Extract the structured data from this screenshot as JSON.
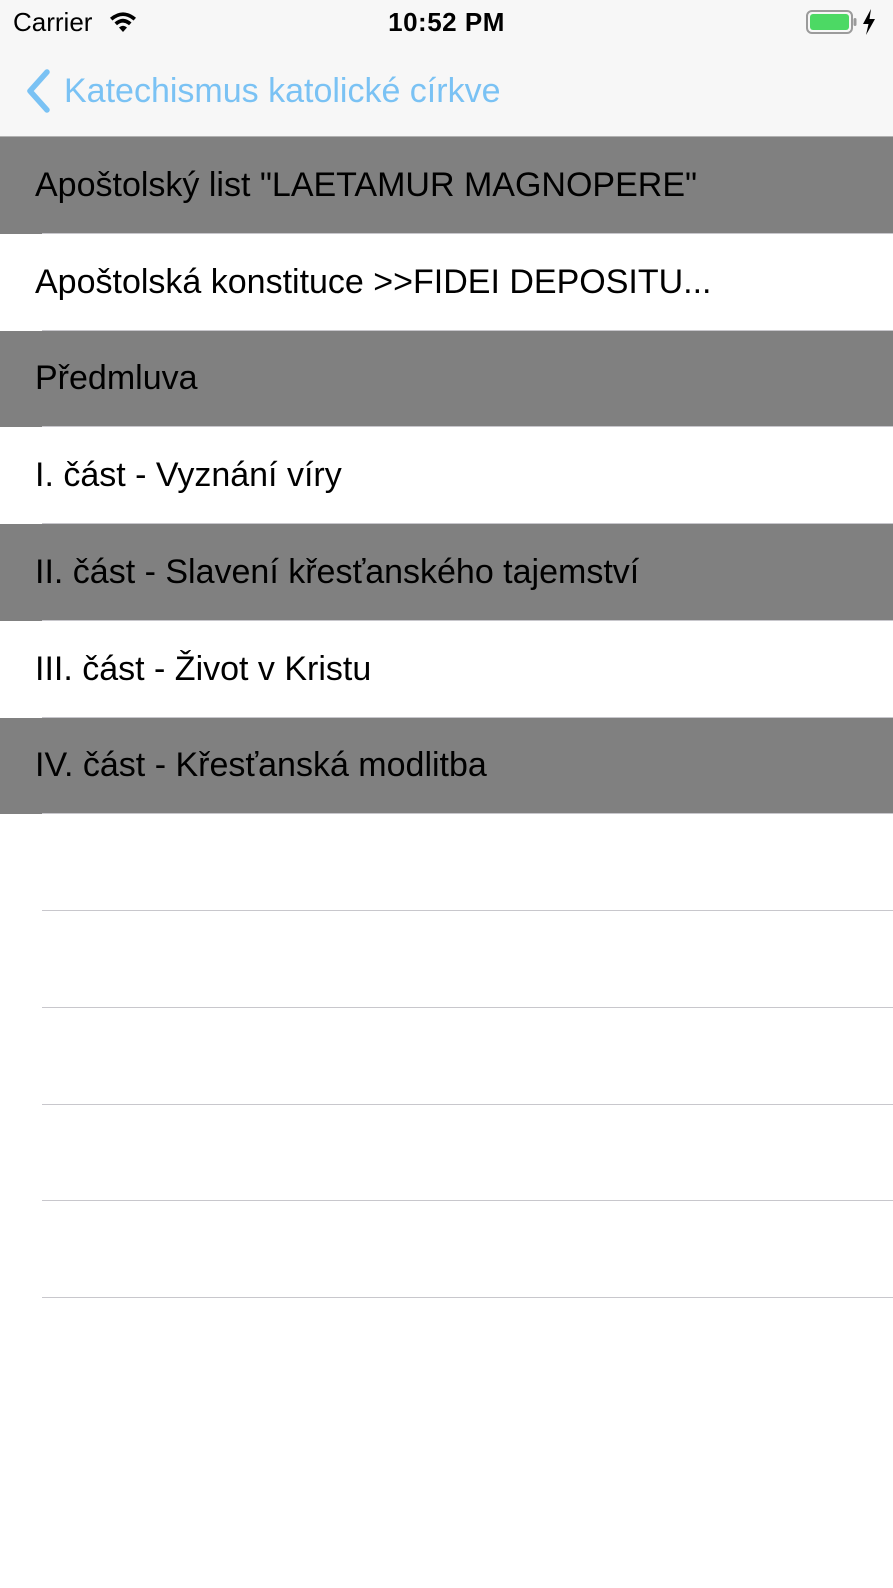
{
  "status_bar": {
    "carrier": "Carrier",
    "time": "10:52 PM",
    "battery_color": "#4cd964"
  },
  "nav": {
    "back_label": "Katechismus katolické církve",
    "accent_color": "#7ac2f4"
  },
  "list": {
    "items": [
      {
        "label": "Apoštolský list \"LAETAMUR MAGNOPERE\""
      },
      {
        "label": "Apoštolská konstituce >>FIDEI DEPOSITU..."
      },
      {
        "label": "Předmluva"
      },
      {
        "label": "I. část - Vyznání víry"
      },
      {
        "label": "II. část - Slavení křesťanského tajemství"
      },
      {
        "label": "III. část - Život v Kristu"
      },
      {
        "label": "IV. část - Křesťanská modlitba"
      }
    ],
    "shaded_color": "#808080"
  }
}
